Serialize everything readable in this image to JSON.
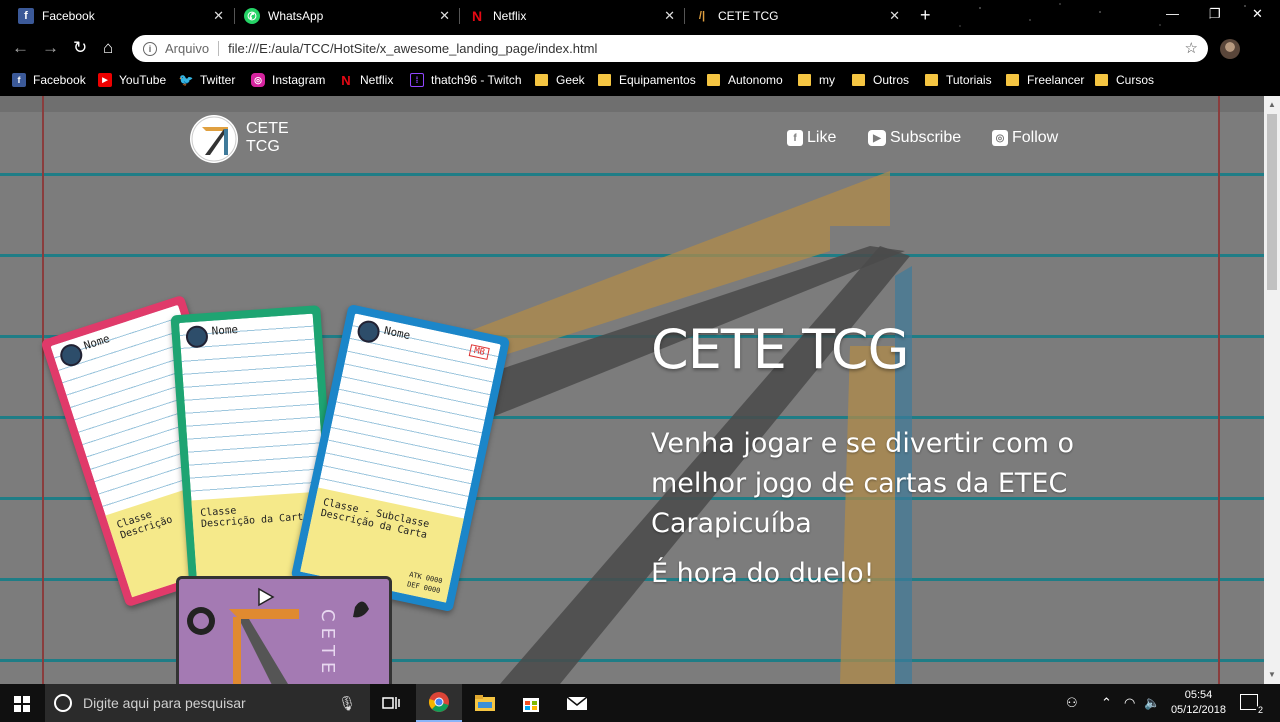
{
  "tabs": [
    {
      "title": "Facebook",
      "icon": "facebook-icon"
    },
    {
      "title": "WhatsApp",
      "icon": "whatsapp-icon"
    },
    {
      "title": "Netflix",
      "icon": "netflix-icon"
    },
    {
      "title": "CETE TCG",
      "icon": "cete-logo-icon",
      "active": true
    }
  ],
  "address": {
    "scheme_label": "Arquivo",
    "url": "file:///E:/aula/TCC/HotSite/x_awesome_landing_page/index.html"
  },
  "bookmarks": [
    {
      "label": "Facebook",
      "type": "site",
      "icon": "facebook-icon"
    },
    {
      "label": "YouTube",
      "type": "site",
      "icon": "youtube-icon"
    },
    {
      "label": "Twitter",
      "type": "site",
      "icon": "twitter-icon"
    },
    {
      "label": "Instagram",
      "type": "site",
      "icon": "instagram-icon"
    },
    {
      "label": "Netflix",
      "type": "site",
      "icon": "netflix-icon"
    },
    {
      "label": "thatch96 - Twitch",
      "type": "site",
      "icon": "twitch-icon"
    },
    {
      "label": "Geek",
      "type": "folder"
    },
    {
      "label": "Equipamentos",
      "type": "folder"
    },
    {
      "label": "Autonomo",
      "type": "folder"
    },
    {
      "label": "my",
      "type": "folder"
    },
    {
      "label": "Outros",
      "type": "folder"
    },
    {
      "label": "Tutoriais",
      "type": "folder"
    },
    {
      "label": "Freelancer",
      "type": "folder"
    },
    {
      "label": "Cursos",
      "type": "folder"
    }
  ],
  "site": {
    "brand_line1": "CETE",
    "brand_line2": "TCG",
    "social": {
      "like": "Like",
      "subscribe": "Subscribe",
      "follow": "Follow"
    },
    "hero_title": "CETE TCG",
    "hero_subtitle": "Venha jogar e se divertir com o melhor jogo de cartas da ETEC Carapicuíba",
    "hero_tagline": "É hora do duelo!"
  },
  "cards": [
    {
      "name": "Nome",
      "note_line1": "Classe",
      "note_line2": "Descrição",
      "color": "#e03a6a"
    },
    {
      "name": "Nome",
      "note_line1": "Classe",
      "note_line2": "Descrição da Carta",
      "color": "#1ea472"
    },
    {
      "name": "Nome",
      "note_line1": "Classe - Subclasse",
      "note_line2": "Descrição da Carta",
      "color": "#1b86c9",
      "tag": "MB",
      "atk": "ATK 0000",
      "def": "DEF 0000"
    }
  ],
  "art_card_text": "CETE",
  "taskbar": {
    "search_placeholder": "Digite aqui para pesquisar",
    "time": "05:54",
    "date": "05/12/2018",
    "notification_count": "2"
  },
  "colors": {
    "page_bg": "#7c7c7c",
    "rule_line": "#1f7d86",
    "margin_line": "#8a3d3d"
  }
}
